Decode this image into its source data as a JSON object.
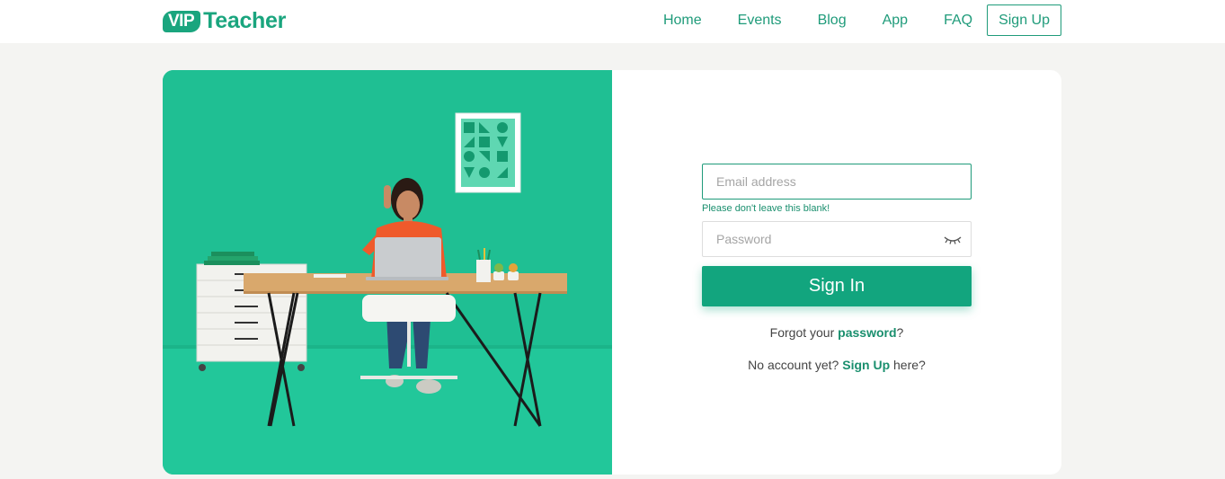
{
  "brand": {
    "badge": "VIP",
    "name": "Teacher"
  },
  "nav": {
    "links": [
      "Home",
      "Events",
      "Blog",
      "App",
      "FAQ"
    ],
    "signup_label": "Sign Up"
  },
  "form": {
    "email_placeholder": "Email address",
    "email_value": "",
    "email_error": "Please don't leave this blank!",
    "password_placeholder": "Password",
    "password_value": "",
    "password_toggle_icon": "eye-closed-icon",
    "submit_label": "Sign In",
    "forgot_prefix": "Forgot your ",
    "forgot_link": "password",
    "forgot_suffix": "?",
    "noacct_prefix": "No account yet? ",
    "noacct_link": "Sign Up",
    "noacct_suffix": " here?"
  },
  "colors": {
    "brand_green": "#1aa57e",
    "hero_background": "#1fbf93",
    "button_green": "#12a57e",
    "page_background": "#f4f4f2"
  }
}
